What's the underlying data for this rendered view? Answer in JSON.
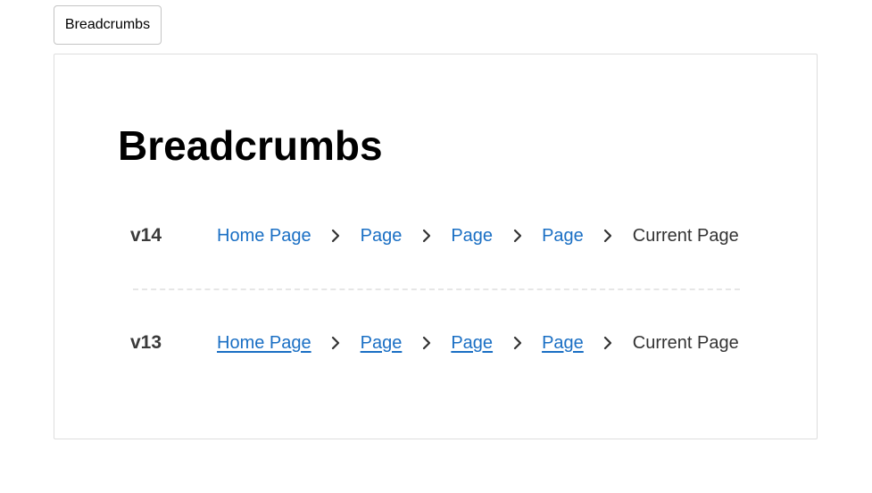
{
  "tab": {
    "label": "Breadcrumbs"
  },
  "card": {
    "title": "Breadcrumbs",
    "rows": [
      {
        "version": "v14",
        "links": [
          "Home Page",
          "Page",
          "Page",
          "Page"
        ],
        "current": "Current Page"
      },
      {
        "version": "v13",
        "links": [
          "Home Page",
          "Page",
          "Page",
          "Page"
        ],
        "current": "Current Page"
      }
    ]
  },
  "icons": {
    "separator": "chevron-right-icon"
  },
  "colors": {
    "link": "#1a6fc4",
    "text": "#333333",
    "version": "#3a3a3a",
    "border": "#dddddd"
  }
}
